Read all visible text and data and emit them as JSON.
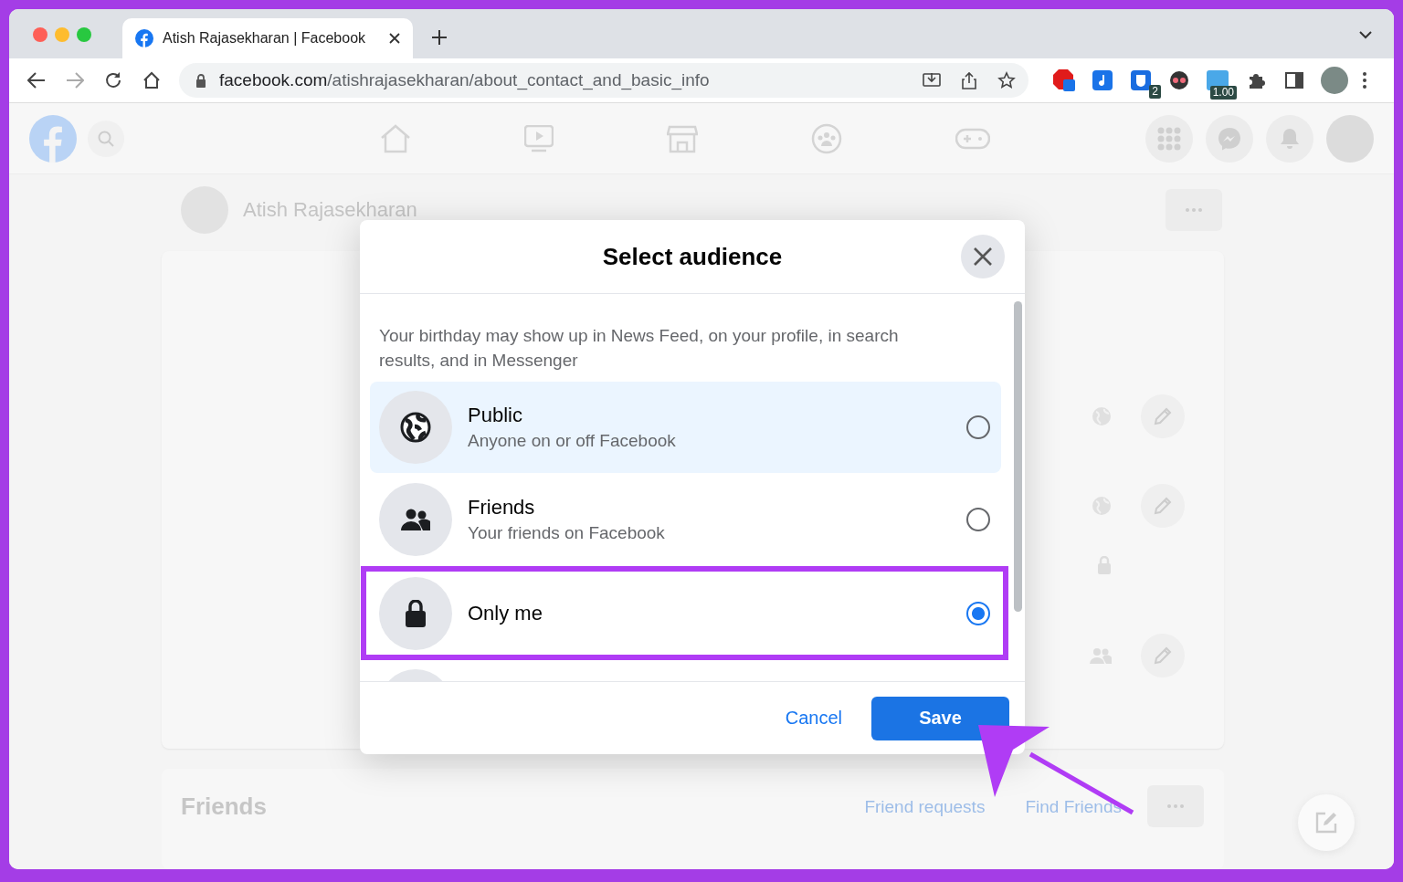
{
  "browser": {
    "tab_title": "Atish Rajasekharan | Facebook",
    "url_domain": "facebook.com",
    "url_path": "/atishrajasekharan/about_contact_and_basic_info",
    "extensions": [
      {
        "kind": "hand"
      },
      {
        "kind": "note"
      },
      {
        "kind": "shield",
        "badge": "2"
      },
      {
        "kind": "mask"
      },
      {
        "kind": "speed",
        "badge": "1.00"
      },
      {
        "kind": "puzzle"
      },
      {
        "kind": "sidebar"
      }
    ]
  },
  "facebook": {
    "profile_name": "Atish Rajasekharan",
    "info_rows": [
      {
        "kind": "globe",
        "editable": true
      },
      {
        "kind": "globe",
        "editable": true
      },
      {
        "kind": "lock",
        "editable": false
      },
      {
        "kind": "friends",
        "editable": true
      }
    ],
    "friends_section": {
      "title": "Friends",
      "links": [
        "Friend requests",
        "Find Friends"
      ]
    }
  },
  "dialog": {
    "title": "Select audience",
    "description": "Your birthday may show up in News Feed, on your profile, in search results, and in Messenger",
    "options": [
      {
        "kind": "globe",
        "label": "Public",
        "sublabel": "Anyone on or off Facebook",
        "selected": false,
        "hovered": true
      },
      {
        "kind": "friends",
        "label": "Friends",
        "sublabel": "Your friends on Facebook",
        "selected": false,
        "hovered": false
      },
      {
        "kind": "lock",
        "label": "Only me",
        "selected": true,
        "hovered": false
      }
    ],
    "cancel": "Cancel",
    "save": "Save"
  }
}
